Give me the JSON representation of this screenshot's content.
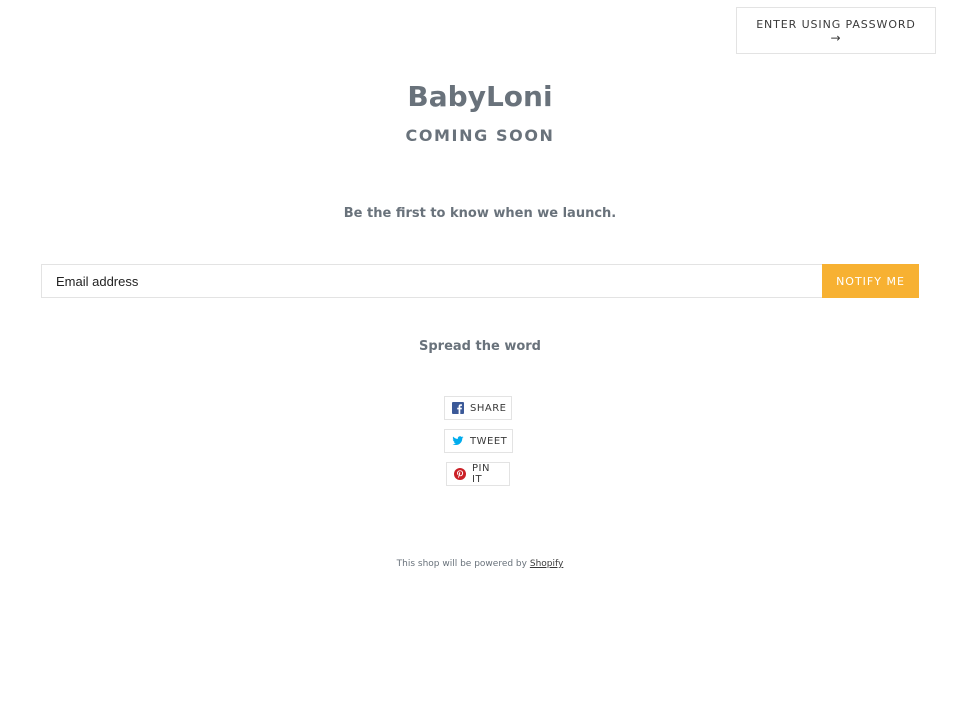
{
  "header": {
    "password_label": "ENTER USING PASSWORD",
    "password_arrow": "→"
  },
  "hero": {
    "shop_name": "BabyLoni",
    "coming_soon": "COMING SOON"
  },
  "signup": {
    "tagline": "Be the first to know when we launch.",
    "email_placeholder": "Email address",
    "notify_label": "NOTIFY ME"
  },
  "share": {
    "heading": "Spread the word",
    "facebook_label": "SHARE",
    "twitter_label": "TWEET",
    "pinterest_label": "PIN IT"
  },
  "footer": {
    "powered_text": "This shop will be powered by",
    "shopify_link": "Shopify"
  },
  "colors": {
    "accent": "#f7b132",
    "text": "#69727b",
    "border": "#e3e3e3",
    "facebook": "#3b5998",
    "twitter": "#00aced",
    "pinterest": "#cb2027"
  }
}
